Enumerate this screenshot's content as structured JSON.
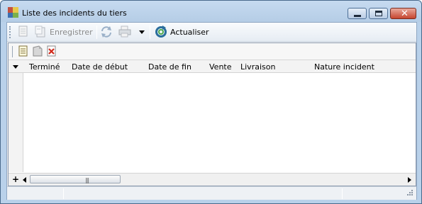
{
  "window": {
    "title": "Liste des incidents du tiers",
    "controls": {
      "minimize": "minimize",
      "maximize": "maximize",
      "close": "close"
    }
  },
  "toolbar": {
    "save_label": "Enregistrer",
    "refresh_label": "Actualiser"
  },
  "grid": {
    "columns": [
      "Terminé",
      "Date de début",
      "Date de fin",
      "Vente",
      "Livraison",
      "Nature incident"
    ],
    "add_row_label": "+"
  },
  "statusbar": {
    "cells": [
      "",
      "",
      ""
    ]
  }
}
